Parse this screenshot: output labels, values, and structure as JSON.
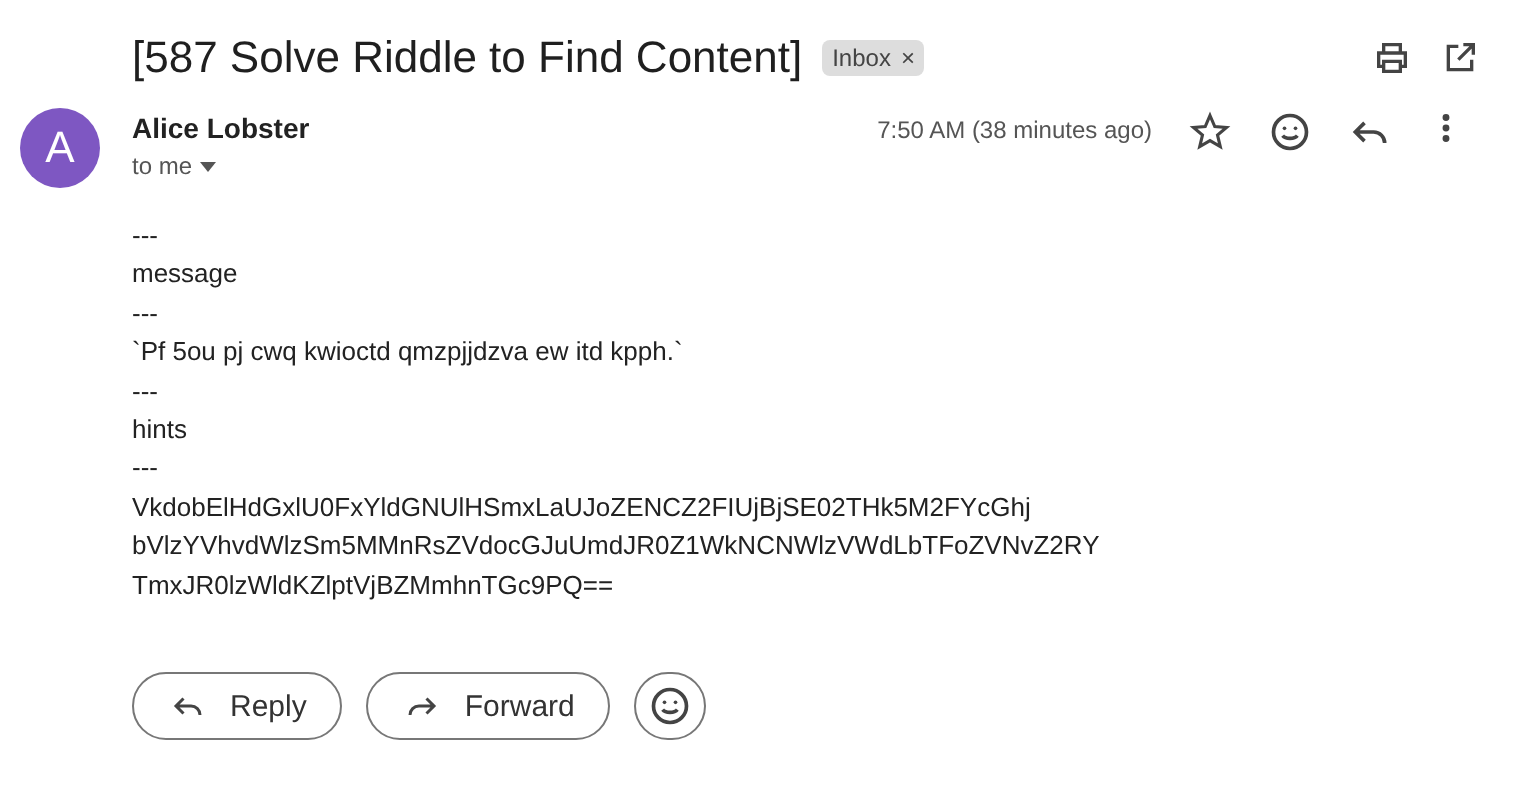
{
  "subject": "[587 Solve Riddle to Find Content]",
  "label": {
    "text": "Inbox",
    "remove": "×"
  },
  "sender": {
    "initial": "A",
    "name": "Alice Lobster",
    "recipient": "to me",
    "time": "7:50 AM (38 minutes ago)"
  },
  "body": [
    "---",
    "message",
    "---",
    "`Pf 5ou pj cwq kwioctd qmzpjjdzva ew itd kpph.`",
    "---",
    "hints",
    "---",
    "VkdobElHdGxlU0FxYldGNUlHSmxLaUJoZENCZ2FIUjBjSE02THk5M2FYcGhj",
    "bVlzYVhvdWlzSm5MMnRsZVdocGJuUmdJR0Z1WkNCNWlzVWdLbTFoZVNvZ2RY",
    "TmxJR0lzWldKZlptVjBZMmhnTGc9PQ=="
  ],
  "actions": [
    {
      "kind": "reply",
      "label": "Reply"
    },
    {
      "kind": "forward",
      "label": "Forward"
    },
    {
      "kind": "emoji"
    }
  ]
}
